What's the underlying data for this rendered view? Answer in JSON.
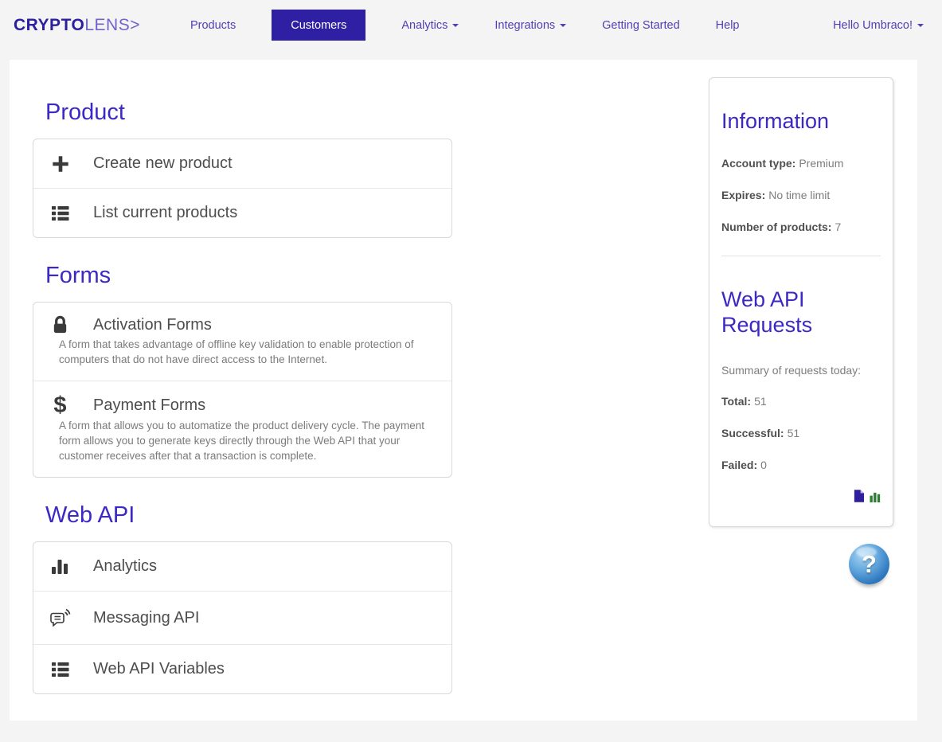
{
  "brand": {
    "name_bold": "CRYPTO",
    "name_light": "LENS>"
  },
  "nav": {
    "products": "Products",
    "customers": "Customers",
    "analytics": "Analytics",
    "integrations": "Integrations",
    "getting_started": "Getting Started",
    "help": "Help",
    "user_greeting": "Hello Umbraco!"
  },
  "product_section": {
    "title": "Product",
    "items": [
      {
        "icon": "plus-icon",
        "label": "Create new product"
      },
      {
        "icon": "list-icon",
        "label": "List current products"
      }
    ]
  },
  "forms_section": {
    "title": "Forms",
    "items": [
      {
        "icon": "lock-icon",
        "label": "Activation Forms",
        "description": "A form that takes advantage of offline key validation to enable protection of computers that do not have direct access to the Internet."
      },
      {
        "icon": "dollar-icon",
        "label": "Payment Forms",
        "description": "A form that allows you to automatize the product delivery cycle. The payment form allows you to generate keys directly through the Web API that your customer receives after that a transaction is complete."
      }
    ]
  },
  "webapi_section": {
    "title": "Web API",
    "items": [
      {
        "icon": "bar-chart-icon",
        "label": "Analytics"
      },
      {
        "icon": "messaging-icon",
        "label": "Messaging API"
      },
      {
        "icon": "list-icon",
        "label": "Web API Variables"
      }
    ]
  },
  "information_panel": {
    "title": "Information",
    "account_type_label": "Account type:",
    "account_type_value": "Premium",
    "expires_label": "Expires:",
    "expires_value": "No time limit",
    "products_label": "Number of products:",
    "products_value": "7"
  },
  "webapi_requests_panel": {
    "title": "Web API Requests",
    "summary": "Summary of requests today:",
    "total_label": "Total:",
    "total_value": "51",
    "successful_label": "Successful:",
    "successful_value": "51",
    "failed_label": "Failed:",
    "failed_value": "0",
    "icons": [
      "report-file-icon",
      "bar-chart-icon"
    ]
  },
  "help_widget": {
    "question_mark": "?"
  },
  "colors": {
    "accent_heading": "#3c28c5",
    "nav_link": "#5140b5",
    "active_button_bg": "#2f1fa3",
    "brand_bold": "#2b1f9e",
    "brand_light": "#7263cc",
    "doc_icon_purple": "#2d1fa0",
    "chart_icon_green": "#2e7d33",
    "help_sphere_blue": "#3079c0"
  }
}
